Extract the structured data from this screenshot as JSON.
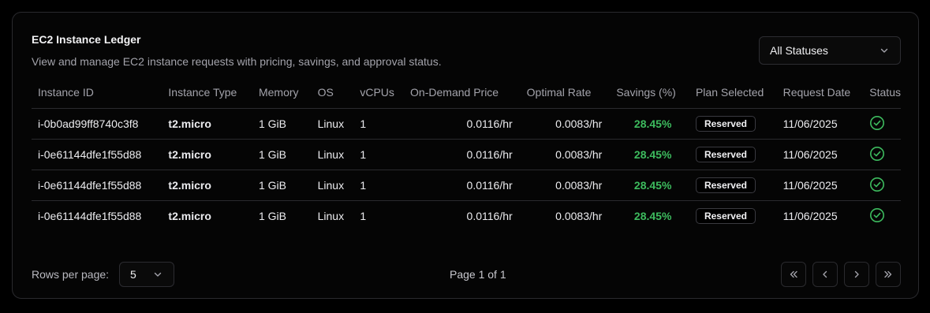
{
  "card": {
    "title": "EC2 Instance Ledger",
    "subtitle": "View and manage EC2 instance requests with pricing, savings, and approval status."
  },
  "status_filter": {
    "selected": "All Statuses",
    "icon": "chevron-down-icon"
  },
  "table": {
    "headers": [
      "Instance ID",
      "Instance Type",
      "Memory",
      "OS",
      "vCPUs",
      "On-Demand Price",
      "Optimal Rate",
      "Savings (%)",
      "Plan Selected",
      "Request Date",
      "Status"
    ],
    "rows": [
      {
        "instance_id": "i-0b0ad99ff8740c3f8",
        "type": "t2.micro",
        "memory": "1 GiB",
        "os": "Linux",
        "vcpus": "1",
        "on_demand": "0.0116/hr",
        "optimal": "0.0083/hr",
        "savings": "28.45%",
        "plan": "Reserved",
        "date": "11/06/2025",
        "status_icon": "check-circle-icon"
      },
      {
        "instance_id": "i-0e61144dfe1f55d88",
        "type": "t2.micro",
        "memory": "1 GiB",
        "os": "Linux",
        "vcpus": "1",
        "on_demand": "0.0116/hr",
        "optimal": "0.0083/hr",
        "savings": "28.45%",
        "plan": "Reserved",
        "date": "11/06/2025",
        "status_icon": "check-circle-icon"
      },
      {
        "instance_id": "i-0e61144dfe1f55d88",
        "type": "t2.micro",
        "memory": "1 GiB",
        "os": "Linux",
        "vcpus": "1",
        "on_demand": "0.0116/hr",
        "optimal": "0.0083/hr",
        "savings": "28.45%",
        "plan": "Reserved",
        "date": "11/06/2025",
        "status_icon": "check-circle-icon"
      },
      {
        "instance_id": "i-0e61144dfe1f55d88",
        "type": "t2.micro",
        "memory": "1 GiB",
        "os": "Linux",
        "vcpus": "1",
        "on_demand": "0.0116/hr",
        "optimal": "0.0083/hr",
        "savings": "28.45%",
        "plan": "Reserved",
        "date": "11/06/2025",
        "status_icon": "check-circle-icon"
      }
    ]
  },
  "pagination": {
    "rows_label": "Rows per page:",
    "rows_value": "5",
    "page_info": "Page 1 of 1",
    "buttons": [
      "first-page-icon",
      "previous-page-icon",
      "next-page-icon",
      "last-page-icon"
    ]
  },
  "colors": {
    "savings": "#3dbb5e",
    "status_ok": "#3dbb5e",
    "border": "#2a2a2e",
    "background": "#000000"
  }
}
